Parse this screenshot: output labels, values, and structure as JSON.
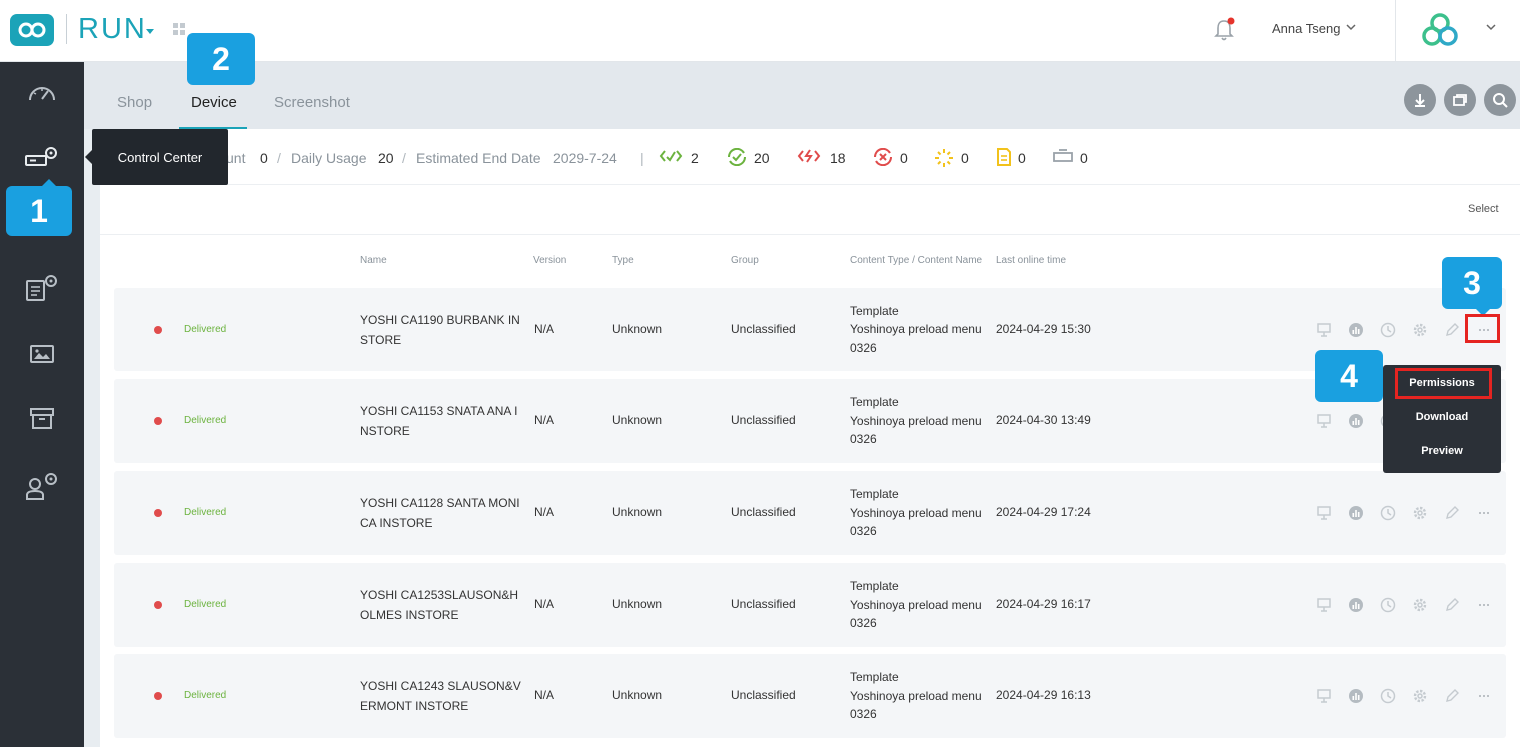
{
  "header": {
    "app_title": "RUN",
    "user_name": "Anna Tseng"
  },
  "tabs": [
    "Shop",
    "Device",
    "Screenshot"
  ],
  "tooltip": "Control Center",
  "stats": {
    "count_label_partial": "unt",
    "count_value": "0",
    "daily_usage_label": "Daily Usage",
    "daily_usage_value": "20",
    "end_date_label": "Estimated End Date",
    "end_date_value": "2029-7-24",
    "sep": "/",
    "icon_counts": [
      "2",
      "20",
      "18",
      "0",
      "0",
      "0",
      "0"
    ]
  },
  "select_label": "Select",
  "columns": {
    "name": "Name",
    "version": "Version",
    "type": "Type",
    "group": "Group",
    "content": "Content Type / Content Name",
    "last_online": "Last online time"
  },
  "rows": [
    {
      "status": "Delivered",
      "name": "YOSHI CA1190 BURBANK IN STORE",
      "version": "N/A",
      "type": "Unknown",
      "group": "Unclassified",
      "content_type": "Template",
      "content_name": "Yoshinoya preload menu 0326",
      "last_online": "2024-04-29 15:30"
    },
    {
      "status": "Delivered",
      "name": "YOSHI CA1153 SNATA ANA I NSTORE",
      "version": "N/A",
      "type": "Unknown",
      "group": "Unclassified",
      "content_type": "Template",
      "content_name": "Yoshinoya preload menu 0326",
      "last_online": "2024-04-30 13:49"
    },
    {
      "status": "Delivered",
      "name": "YOSHI CA1128 SANTA MONI CA INSTORE",
      "version": "N/A",
      "type": "Unknown",
      "group": "Unclassified",
      "content_type": "Template",
      "content_name": "Yoshinoya preload menu 0326",
      "last_online": "2024-04-29 17:24"
    },
    {
      "status": "Delivered",
      "name": "YOSHI CA1253SLAUSON&H OLMES INSTORE",
      "version": "N/A",
      "type": "Unknown",
      "group": "Unclassified",
      "content_type": "Template",
      "content_name": "Yoshinoya preload menu 0326",
      "last_online": "2024-04-29 16:17"
    },
    {
      "status": "Delivered",
      "name": "YOSHI CA1243 SLAUSON&V ERMONT INSTORE",
      "version": "N/A",
      "type": "Unknown",
      "group": "Unclassified",
      "content_type": "Template",
      "content_name": "Yoshinoya preload menu 0326",
      "last_online": "2024-04-29 16:13"
    }
  ],
  "dropdown": [
    "Permissions",
    "Download",
    "Preview"
  ],
  "callouts": [
    "1",
    "2",
    "3",
    "4"
  ],
  "colors": {
    "accent": "#1ba3b8",
    "callout": "#1aa0e0",
    "highlight": "#e52421",
    "sidebar": "#2b3037",
    "delivered": "#6cb33f",
    "status_dot": "#e04c4c"
  },
  "icons": {
    "sidebar": [
      "dashboard-gauge-icon",
      "control-center-icon",
      "schedule-settings-icon",
      "media-image-icon",
      "archive-box-icon",
      "user-settings-icon"
    ],
    "toolbar": [
      "download-icon",
      "window-icon",
      "search-icon"
    ],
    "stats": [
      "code-check-icon",
      "check-sync-icon",
      "broken-link-icon",
      "sync-error-icon",
      "loading-icon",
      "document-icon",
      "device-icon"
    ],
    "row_actions": [
      "monitor-icon",
      "chart-icon",
      "clock-icon",
      "gear-icon",
      "pencil-icon",
      "more-icon"
    ]
  }
}
